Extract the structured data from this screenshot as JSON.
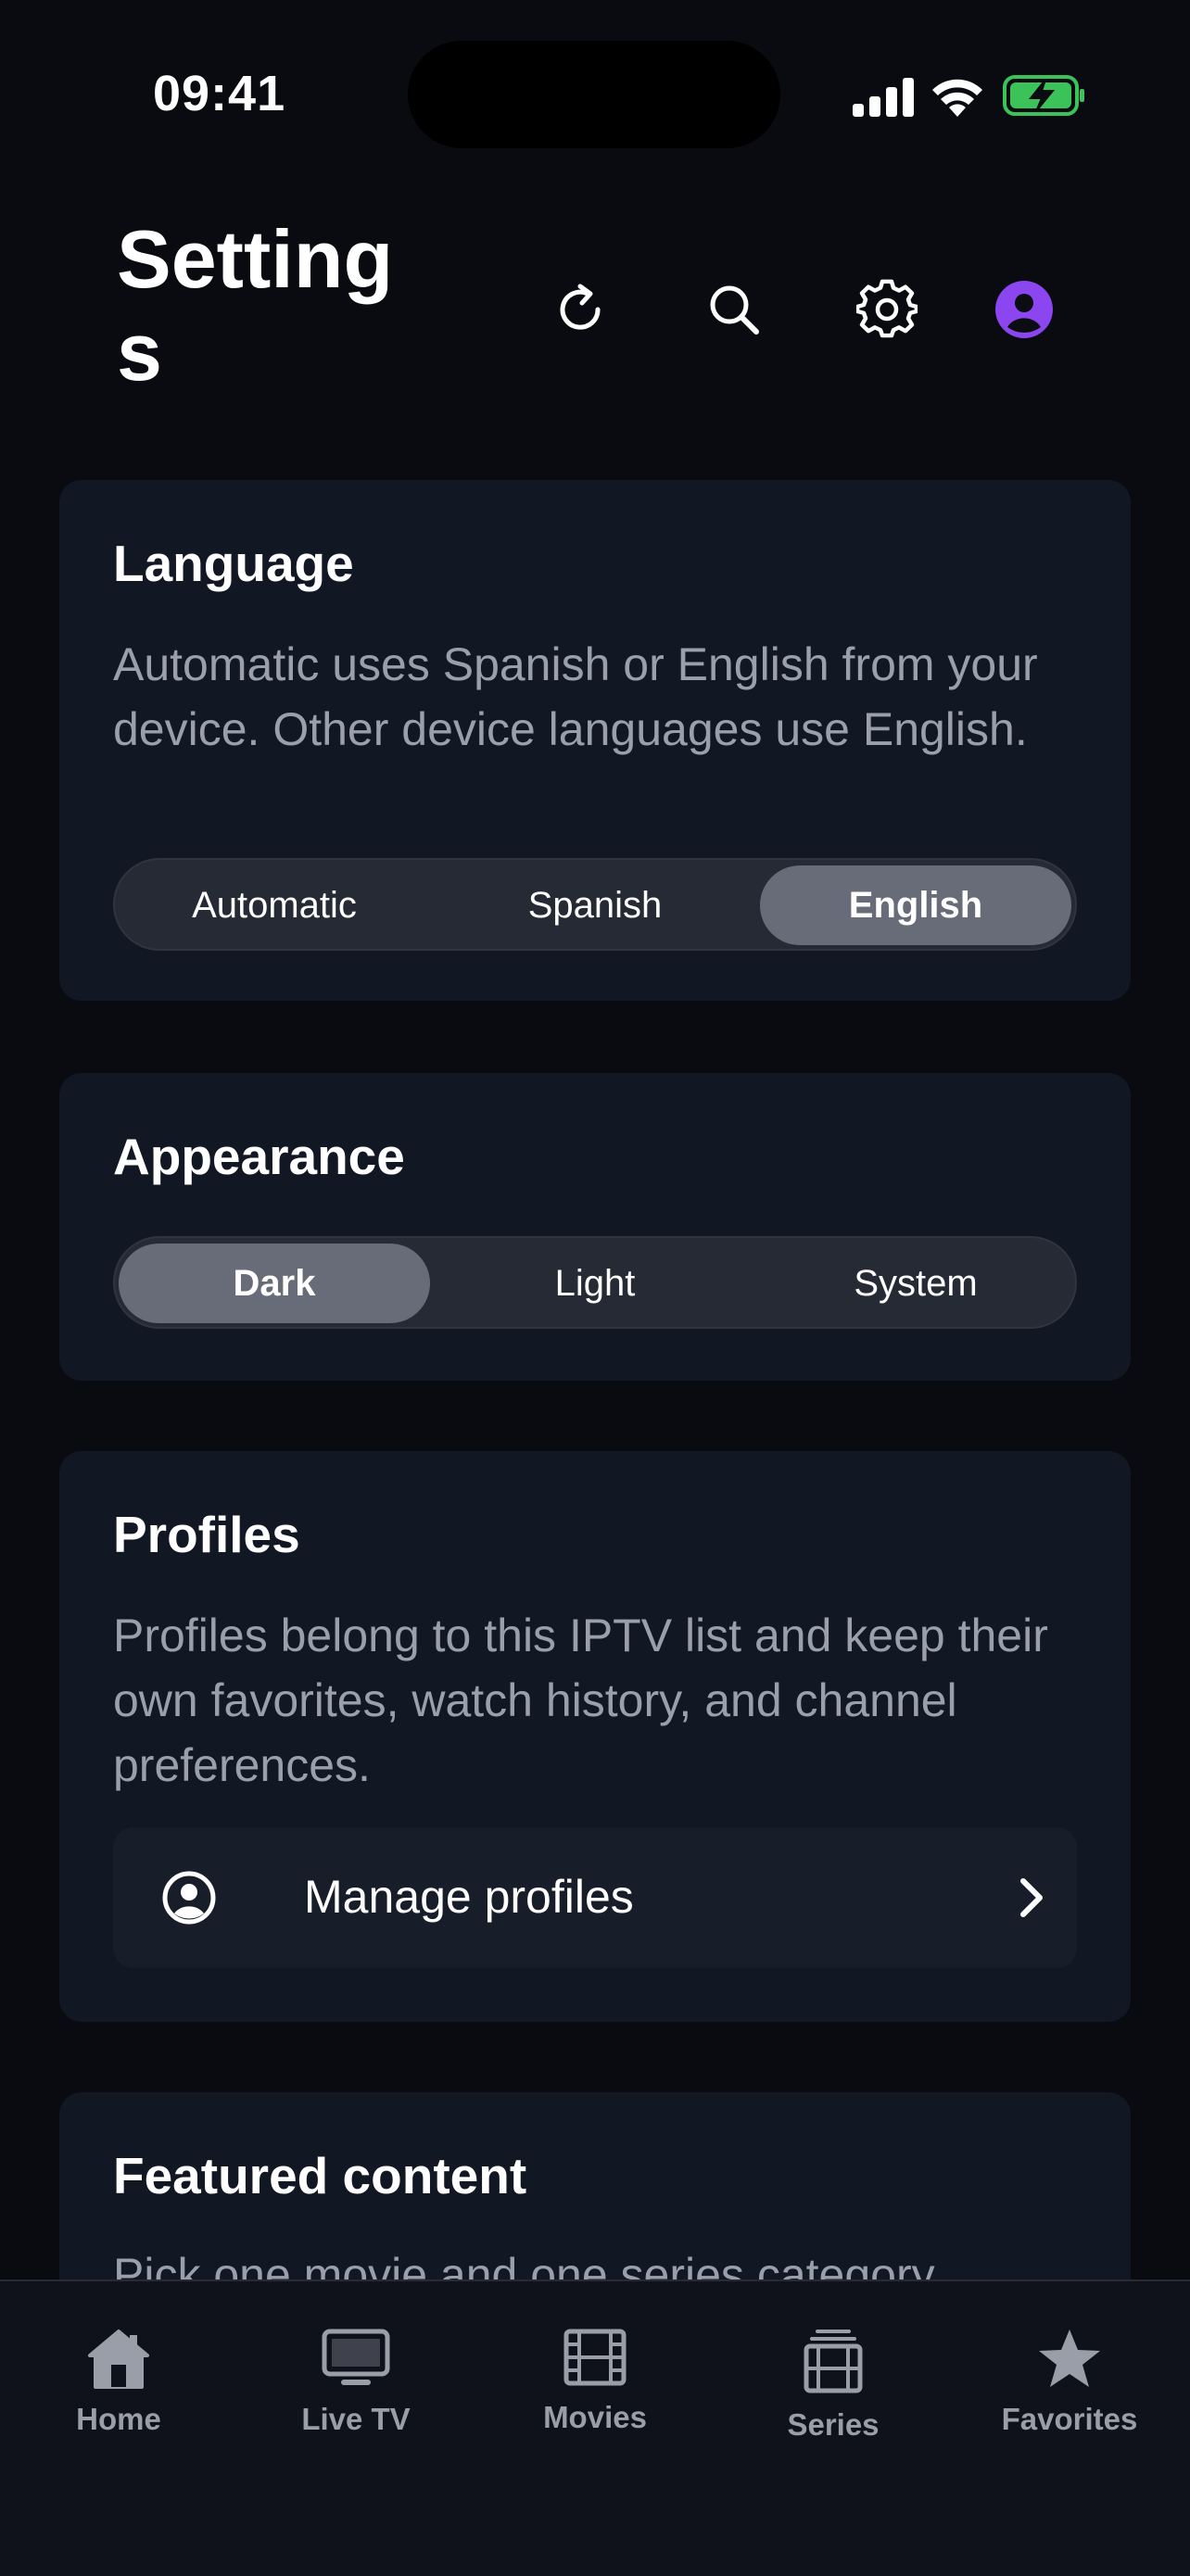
{
  "status_bar": {
    "time": "09:41"
  },
  "header": {
    "title": "Settings",
    "refresh_label": "refresh-icon",
    "search_label": "search-icon",
    "settings_label": "gear-icon",
    "profile_label": "user-avatar-icon"
  },
  "colors": {
    "background": "#090b11",
    "card": "#121724",
    "accent_purple": "#8b46f0",
    "segment_active": "#686c78",
    "battery_green": "#3bc35a",
    "muted_text": "#9aa0ab"
  },
  "language": {
    "title": "Language",
    "description": "Automatic uses Spanish or English from your device. Other device languages use English.",
    "options": [
      "Automatic",
      "Spanish",
      "English"
    ],
    "selected": "English"
  },
  "appearance": {
    "title": "Appearance",
    "options": [
      "Dark",
      "Light",
      "System"
    ],
    "selected": "Dark"
  },
  "profiles": {
    "title": "Profiles",
    "description": "Profiles belong to this IPTV list and keep their own favorites, watch history, and channel preferences.",
    "manage_label": "Manage profiles"
  },
  "featured": {
    "title": "Featured content",
    "description": "Pick one movie and one series category"
  },
  "tabs": [
    {
      "label": "Home",
      "icon": "home-icon"
    },
    {
      "label": "Live TV",
      "icon": "tv-icon"
    },
    {
      "label": "Movies",
      "icon": "film-icon"
    },
    {
      "label": "Series",
      "icon": "series-icon"
    },
    {
      "label": "Favorites",
      "icon": "star-icon"
    }
  ]
}
